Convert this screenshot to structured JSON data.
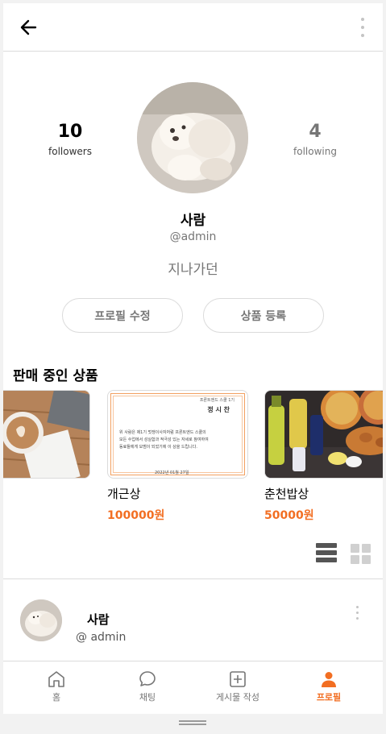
{
  "header": {
    "back_icon": "arrow-left-icon",
    "more_icon": "more-vertical-icon"
  },
  "profile": {
    "followers_count": "10",
    "followers_label": "followers",
    "following_count": "4",
    "following_label": "following",
    "username": "사람",
    "account": "@admin",
    "intro": "지나가던",
    "edit_button": "프로필 수정",
    "add_product_button": "상품 등록"
  },
  "products": {
    "title": "판매 중인 상품",
    "items": [
      {
        "name": "",
        "price": ""
      },
      {
        "name": "개근상",
        "price": "100000원"
      },
      {
        "name": "춘천밥상",
        "price": "50000원"
      }
    ],
    "certificate": {
      "line1": "프론트엔드 스쿨 1기",
      "line2": "정 시 찬",
      "line3": "위 사람은 제1기 멋쟁이사자처럼 프론트엔드 스쿨의",
      "line4": "모든 수업에서 성실함과 적극성 있는 자세로 참여하여",
      "line5": "동료들에게 모범이 되었기에 이 상을 드립니다.",
      "date": "2022년 01월 27일"
    }
  },
  "post": {
    "username": "사람",
    "account": "@ admin"
  },
  "tabbar": {
    "home": "홈",
    "chat": "채팅",
    "write": "게시물 작성",
    "profile": "프로필"
  },
  "colors": {
    "accent": "#F26E22",
    "border": "#DBDBDB",
    "muted": "#767676"
  }
}
